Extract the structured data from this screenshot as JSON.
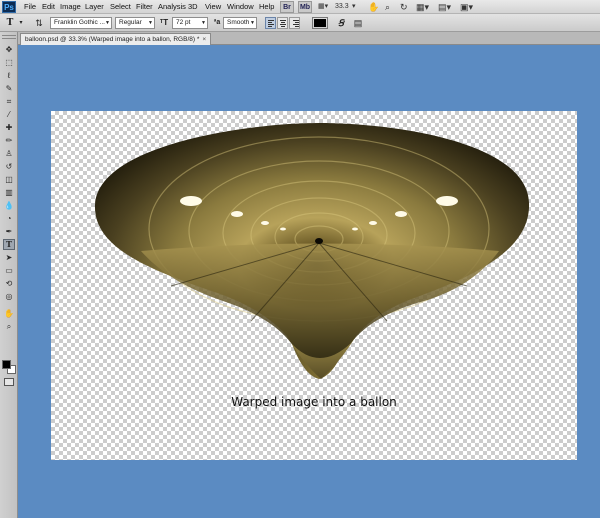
{
  "menubar": {
    "items": [
      "File",
      "Edit",
      "Image",
      "Layer",
      "Select",
      "Filter",
      "Analysis",
      "3D",
      "View",
      "Window",
      "Help"
    ],
    "zoom": "33.3"
  },
  "options": {
    "tool_glyph": "T",
    "font_family": "Franklin Gothic ...",
    "font_style": "Regular",
    "font_size": "72 pt",
    "antialias": "Smooth",
    "text_color": "#000000"
  },
  "document": {
    "tab_title": "balloon.psd @ 33.3% (Warped image into a ballon, RGB/8) *",
    "caption": "Warped image into a ballon"
  },
  "colors": {
    "workspace": "#5b8bc2",
    "foreground": "#000000",
    "background": "#ffffff"
  },
  "tools": [
    "move-icon",
    "marquee-icon",
    "lasso-icon",
    "quick-select-icon",
    "crop-icon",
    "eyedropper-icon",
    "healing-icon",
    "brush-icon",
    "clone-stamp-icon",
    "history-brush-icon",
    "eraser-icon",
    "gradient-icon",
    "blur-icon",
    "dodge-icon",
    "pen-icon",
    "type-icon",
    "path-select-icon",
    "shape-icon",
    "3d-rotate-icon",
    "3d-orbit-icon",
    "hand-icon",
    "zoom-icon"
  ]
}
